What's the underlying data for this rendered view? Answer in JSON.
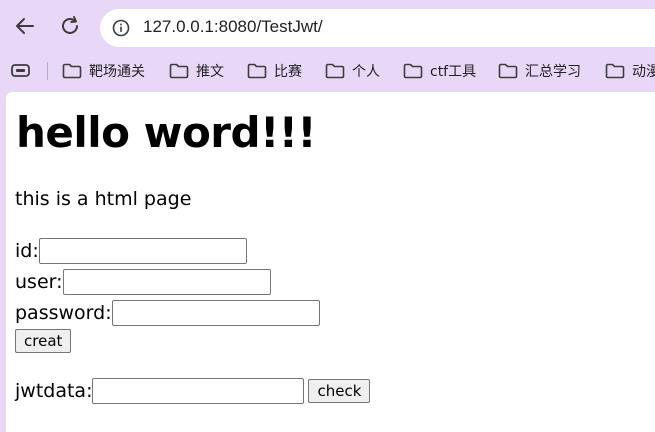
{
  "browser": {
    "url": "127.0.0.1:8080/TestJwt/"
  },
  "bookmarks": [
    {
      "label": "靶场通关",
      "icon": "folder-icon"
    },
    {
      "label": "推文",
      "icon": "folder-icon"
    },
    {
      "label": "比赛",
      "icon": "folder-icon"
    },
    {
      "label": "个人",
      "icon": "folder-icon"
    },
    {
      "label": "ctf工具",
      "icon": "folder-icon"
    },
    {
      "label": "汇总学习",
      "icon": "folder-icon"
    },
    {
      "label": "动漫",
      "icon": "folder-icon"
    }
  ],
  "page": {
    "heading": "hello word!!!",
    "paragraph": "this is a html page",
    "form": {
      "id_label": "id:",
      "id_value": "",
      "user_label": "user:",
      "user_value": "",
      "password_label": "password:",
      "password_value": "",
      "creat_button": "creat",
      "jwtdata_label": "jwtdata:",
      "jwtdata_value": "",
      "check_button": "check"
    }
  },
  "colors": {
    "chrome_background": "#e9d7f8",
    "page_background": "#ffffff"
  }
}
